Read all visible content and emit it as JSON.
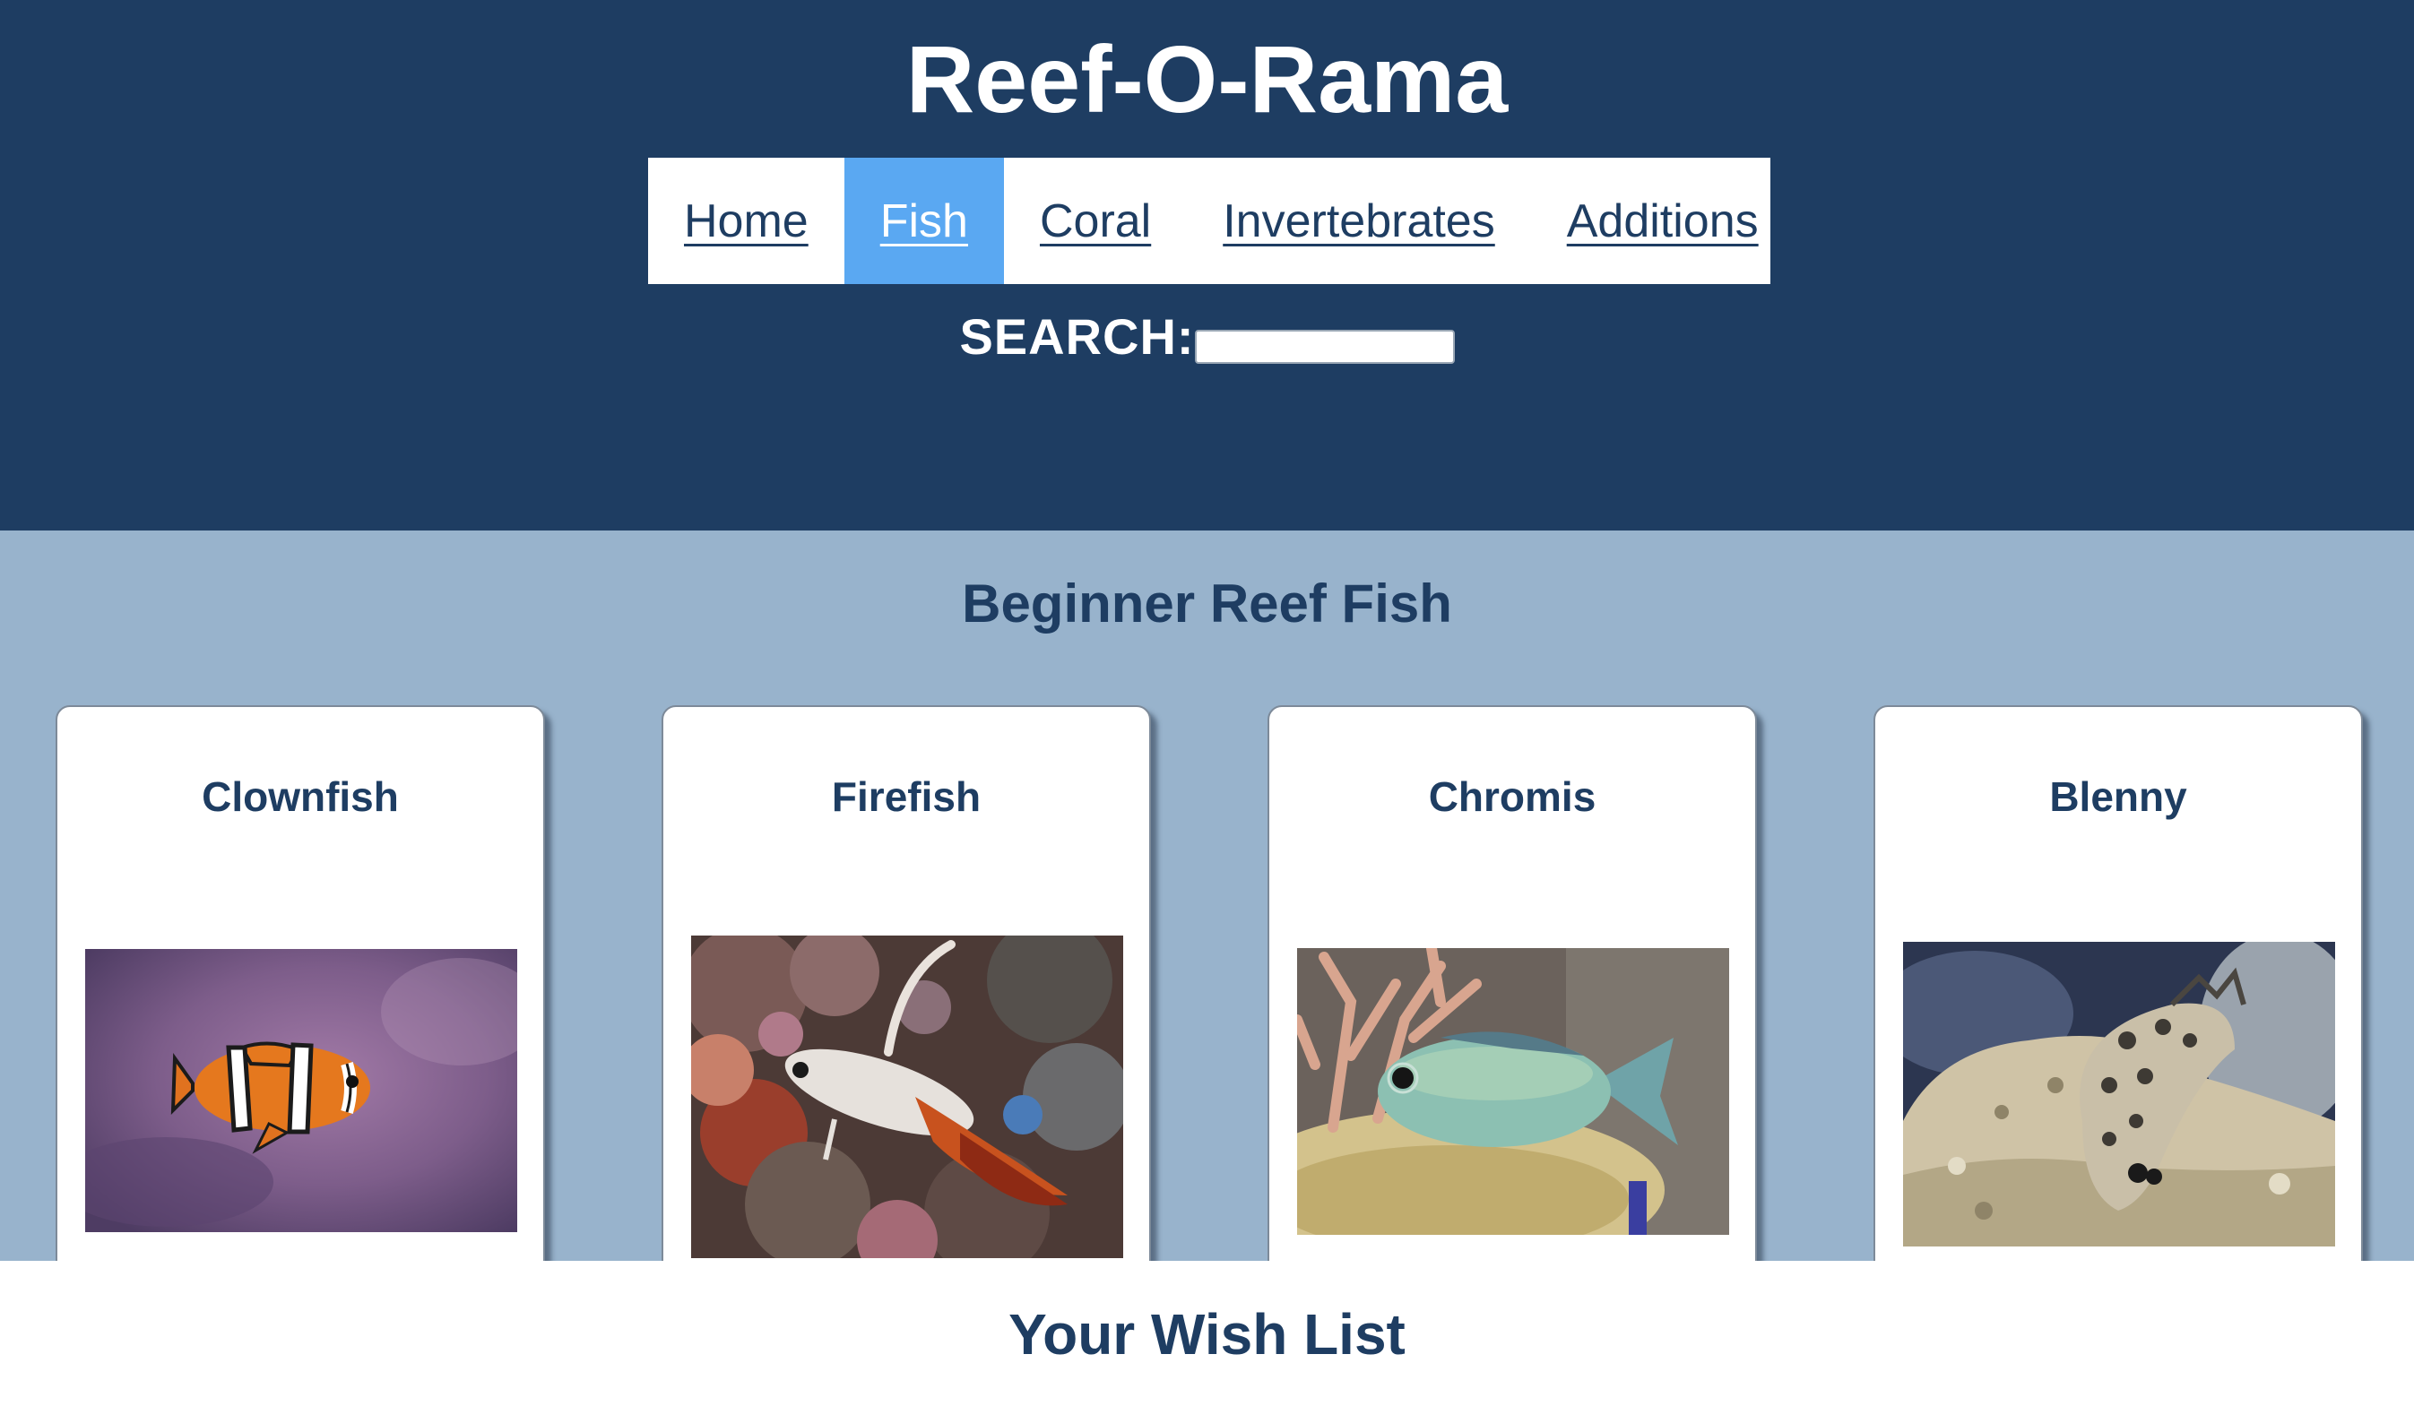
{
  "header": {
    "site_title": "Reef-O-Rama",
    "nav": [
      {
        "label": "Home",
        "active": false
      },
      {
        "label": "Fish",
        "active": true
      },
      {
        "label": "Coral",
        "active": false
      },
      {
        "label": "Invertebrates",
        "active": false
      },
      {
        "label": "Additions",
        "active": false
      }
    ],
    "search_label": "SEARCH:",
    "search_value": ""
  },
  "section": {
    "title": "Beginner Reef Fish",
    "cards": [
      {
        "name": "Clownfish"
      },
      {
        "name": "Firefish"
      },
      {
        "name": "Chromis"
      },
      {
        "name": "Blenny"
      }
    ]
  },
  "wishlist": {
    "title": "Your Wish List"
  },
  "colors": {
    "header_bg": "#1e3d62",
    "page_bg": "#98b3cc",
    "nav_active": "#5aa8f2",
    "text_dark": "#1e3d62"
  }
}
